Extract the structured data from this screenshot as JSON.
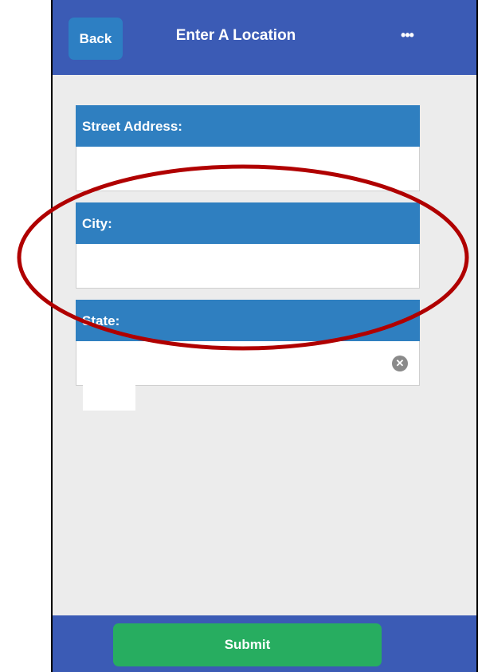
{
  "header": {
    "back_label": "Back",
    "title": "Enter A Location",
    "menu_label": "•••"
  },
  "form": {
    "fields": [
      {
        "label": "Street Address:",
        "value": ""
      },
      {
        "label": "City:",
        "value": ""
      },
      {
        "label": "State:",
        "value": ""
      }
    ],
    "clear_icon": "clear-circle-icon"
  },
  "footer": {
    "submit_label": "Submit"
  },
  "colors": {
    "header_bar": "#3b5bb5",
    "back_button": "#2d7fc3",
    "field_label_bg": "#2f7fc0",
    "submit_button": "#27ad60",
    "annotation_ellipse": "#b00000",
    "page_bg": "#ececec"
  }
}
